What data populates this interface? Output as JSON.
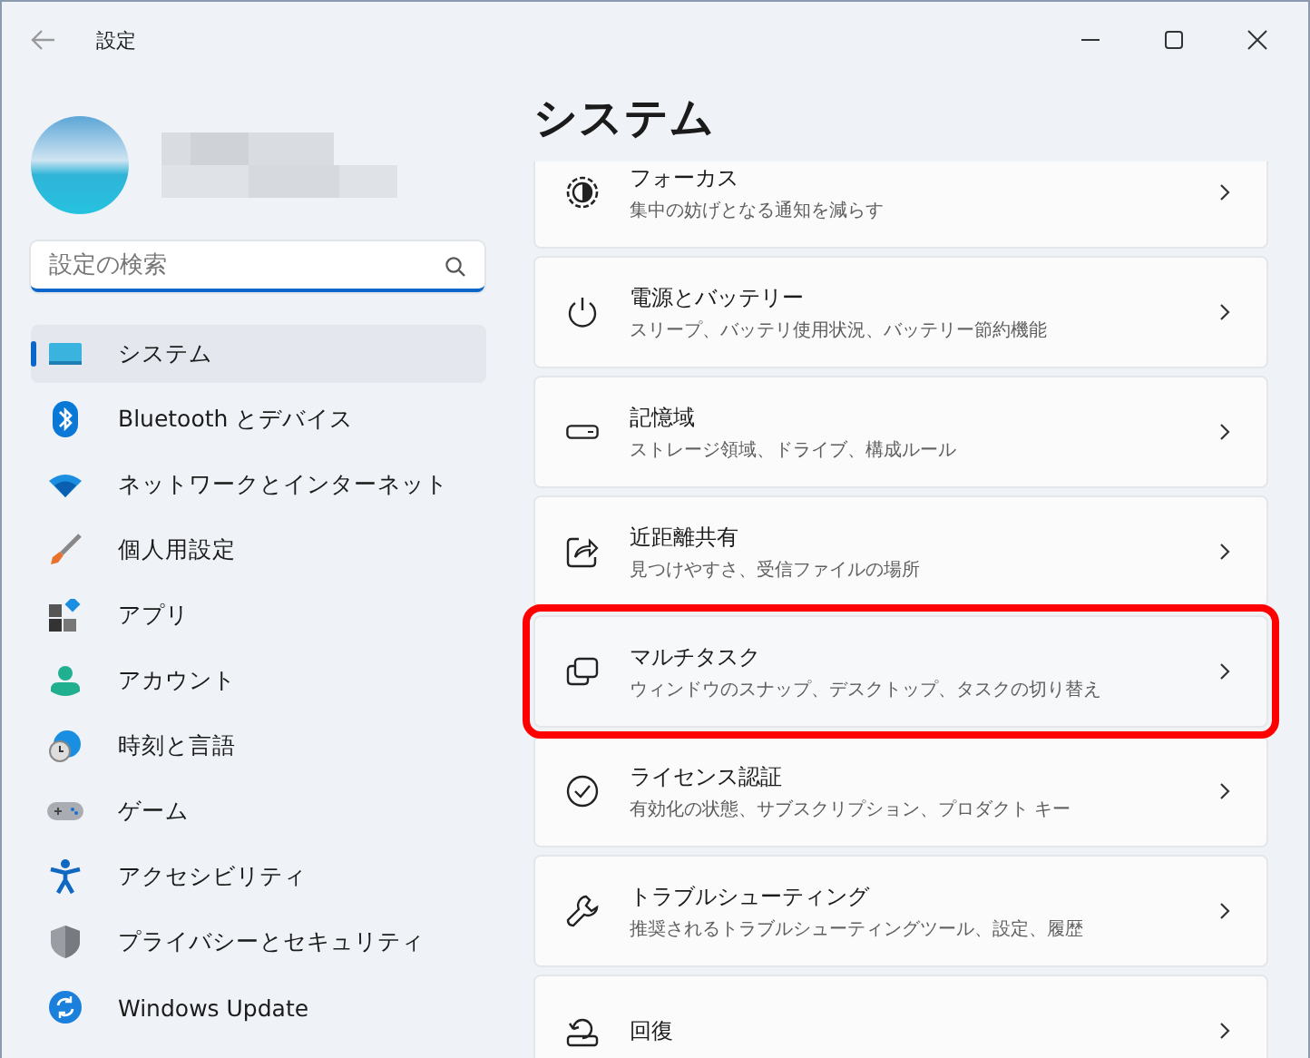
{
  "window": {
    "title": "設定"
  },
  "search": {
    "placeholder": "設定の検索"
  },
  "sidebar": {
    "items": [
      {
        "label": "システム",
        "selected": true
      },
      {
        "label": "Bluetooth とデバイス",
        "selected": false
      },
      {
        "label": "ネットワークとインターネット",
        "selected": false
      },
      {
        "label": "個人用設定",
        "selected": false
      },
      {
        "label": "アプリ",
        "selected": false
      },
      {
        "label": "アカウント",
        "selected": false
      },
      {
        "label": "時刻と言語",
        "selected": false
      },
      {
        "label": "ゲーム",
        "selected": false
      },
      {
        "label": "アクセシビリティ",
        "selected": false
      },
      {
        "label": "プライバシーとセキュリティ",
        "selected": false
      },
      {
        "label": "Windows Update",
        "selected": false
      }
    ]
  },
  "page": {
    "title": "システム",
    "settings": [
      {
        "title": "フォーカス",
        "description": "集中の妨げとなる通知を減らす",
        "highlighted": false
      },
      {
        "title": "電源とバッテリー",
        "description": "スリープ、バッテリ使用状況、バッテリー節約機能",
        "highlighted": false
      },
      {
        "title": "記憶域",
        "description": "ストレージ領域、ドライブ、構成ルール",
        "highlighted": false
      },
      {
        "title": "近距離共有",
        "description": "見つけやすさ、受信ファイルの場所",
        "highlighted": false
      },
      {
        "title": "マルチタスク",
        "description": "ウィンドウのスナップ、デスクトップ、タスクの切り替え",
        "highlighted": true
      },
      {
        "title": "ライセンス認証",
        "description": "有効化の状態、サブスクリプション、プロダクト キー",
        "highlighted": false
      },
      {
        "title": "トラブルシューティング",
        "description": "推奨されるトラブルシューティングツール、設定、履歴",
        "highlighted": false
      },
      {
        "title": "回復",
        "highlighted": false
      }
    ]
  }
}
